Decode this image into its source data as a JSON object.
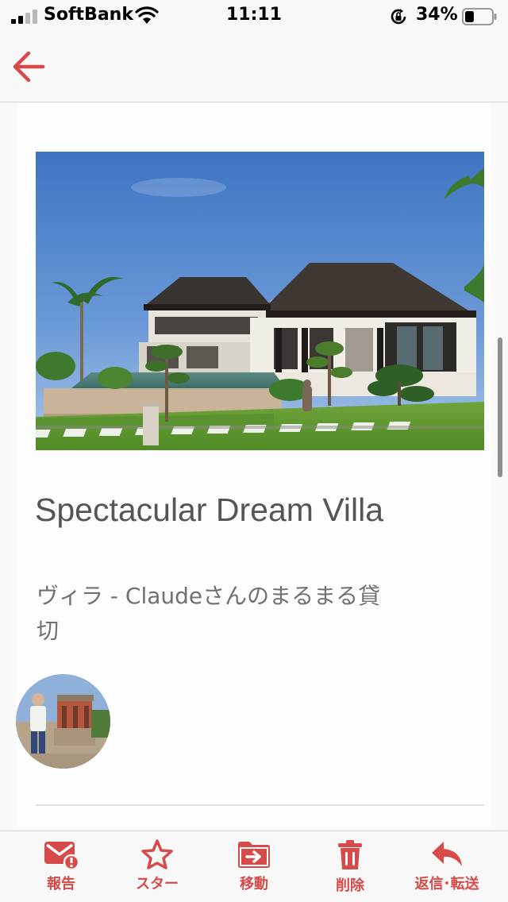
{
  "status_bar": {
    "carrier": "SoftBank",
    "time": "11:11",
    "battery_percent": "34%",
    "battery_level": 0.34
  },
  "nav": {
    "back_icon": "back-arrow-icon"
  },
  "listing": {
    "title": "Spectacular Dream Villa",
    "subtitle": "ヴィラ - Claudeさんのまるまる貸切"
  },
  "toolbar": {
    "items": [
      {
        "label": "報告",
        "icon": "report-mail-icon"
      },
      {
        "label": "スター",
        "icon": "star-icon"
      },
      {
        "label": "移動",
        "icon": "move-folder-icon"
      },
      {
        "label": "削除",
        "icon": "trash-icon"
      },
      {
        "label": "返信･転送",
        "icon": "reply-icon"
      }
    ]
  },
  "colors": {
    "accent": "#d64a4a",
    "title_text": "#555555",
    "subtitle_text": "#707070",
    "bar_background": "#f8f8f8"
  }
}
